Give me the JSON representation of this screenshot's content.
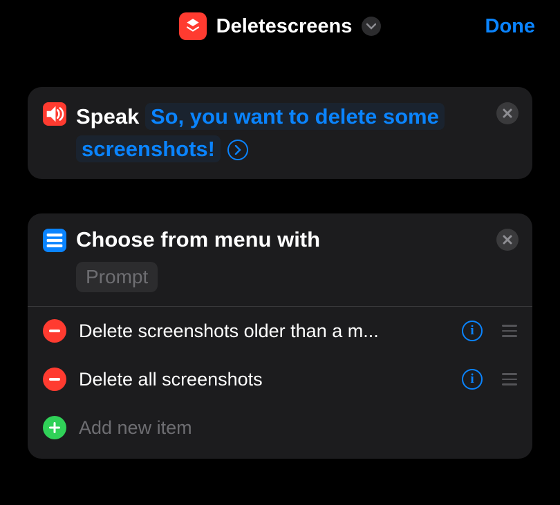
{
  "header": {
    "title": "Deletescreens",
    "done_label": "Done"
  },
  "speak_card": {
    "action_label": "Speak",
    "text": "So, you want to delete some screenshots!"
  },
  "menu_card": {
    "title": "Choose from menu with",
    "prompt_placeholder": "Prompt",
    "items": [
      {
        "label": "Delete screenshots older than a m..."
      },
      {
        "label": "Delete all screenshots"
      }
    ],
    "add_label": "Add new item"
  }
}
